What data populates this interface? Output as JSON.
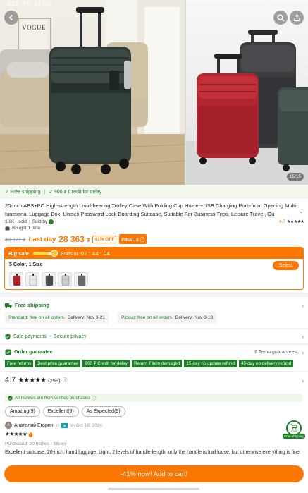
{
  "status_bar": {
    "time": "4:15",
    "date": "Fri, 24 Oct"
  },
  "colors": {
    "accent": "#fb7701",
    "green": "#1a7f25"
  },
  "gallery": {
    "back_icon": "chevron-left-icon",
    "search_icon": "search-icon",
    "share_icon": "share-icon",
    "counter": "15/15",
    "poster_text": "VOGUE"
  },
  "perks": {
    "free_shipping": "Free shipping",
    "credit": "900 ₮ Credit for delay"
  },
  "product": {
    "title": "20-inch ABS+PC High-strength Load-bearing Trolley Case With Folding Cup Holder+USB Charging Port+front Opening Multi-functional Luggage Box, Unisex Password Lock Boarding Suitcase, Suitable For Business Trips, Leisure Travel, Ou",
    "sold": "3.6K+ sold",
    "sold_by": "Sold by",
    "rating": "4.7",
    "bought": "Bought 1 time"
  },
  "price": {
    "old": "48 327 ₮",
    "last_day": "Last day",
    "current": "28 363",
    "currency": "₮",
    "discount": "41% OFF",
    "final": "FINAL 8"
  },
  "sale": {
    "label": "Big sale",
    "progress": 0.75,
    "ends_in_label": "Ends in",
    "timer": "07 : 44 : 04",
    "variant_summary": "5 Color, 1 Size",
    "select_label": "Select",
    "thumb_colors": [
      "#b0252e",
      "#ece9e4",
      "#4a4d50",
      "#c8ccd0",
      "#6e6a66"
    ]
  },
  "shipping": {
    "title": "Free shipping",
    "standard": {
      "label": "Standard: free on all orders.",
      "delivery": "Delivery: Nov 3-21"
    },
    "pickup": {
      "label": "Pickup: free on all orders.",
      "delivery": "Delivery: Nov 3-19"
    }
  },
  "safety": {
    "payments": "Safe payments",
    "privacy": "Secure privacy"
  },
  "order_guarantee": {
    "title": "Order guarantee",
    "count": "6 Temu guarantees",
    "tags": [
      "Free returns",
      "Best price guarantee",
      "900 ₮ Credit for delay",
      "Return if item damaged",
      "15-day no update refund",
      "45-day no delivery refund"
    ]
  },
  "reviews": {
    "score": "4.7",
    "count": "(259)",
    "verified": "All reviews are from verified purchases",
    "filters": [
      "Amazing(9)",
      "Excellent(9)",
      "As Expected(9)"
    ],
    "reviewer": {
      "initial": "А",
      "name": "Анатолий Егорин",
      "in": "in",
      "date": "on Oct 18, 2024"
    },
    "purchased": "Purchased: 20 Inches / Silvery",
    "text": "Excellent suitcase, 20-inch, hand luggage. Light, 2 levels of handle length, only the handle is frail loose, but otherwise everything is fine."
  },
  "cart_fab": {
    "label": "Cart",
    "free": "Free shipping"
  },
  "cta": {
    "add_to_cart": "-41% now! Add to cart!"
  }
}
